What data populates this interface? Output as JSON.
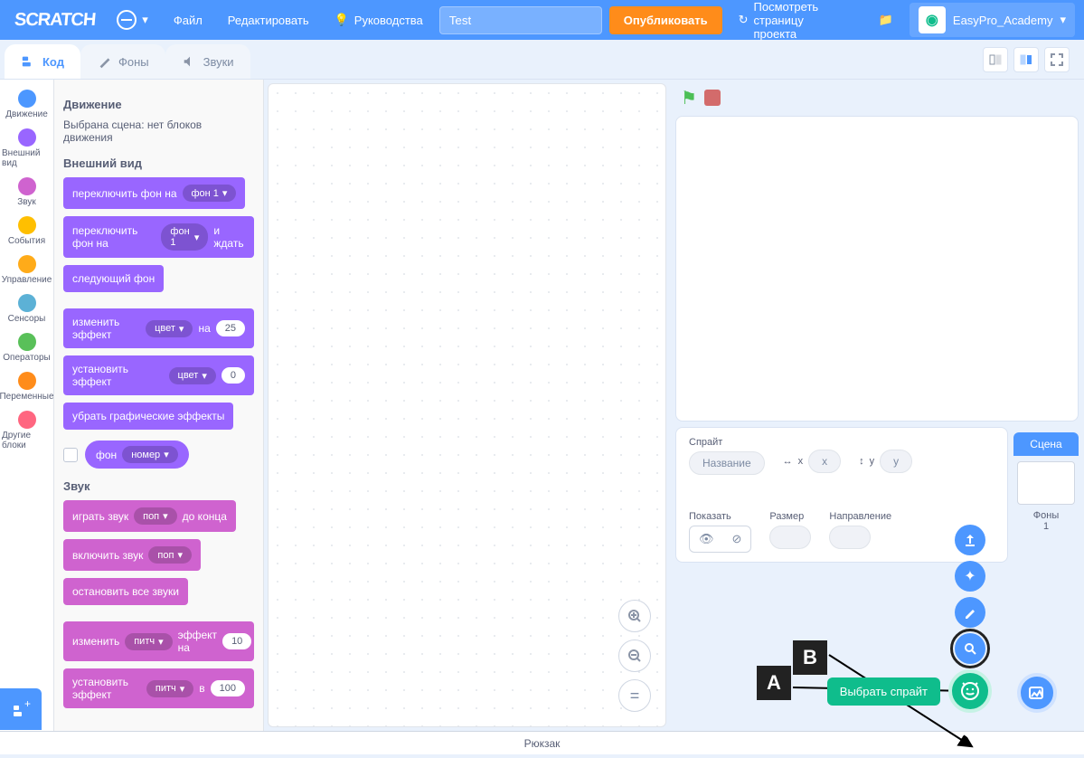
{
  "menubar": {
    "logo": "SCRATCH",
    "file": "Файл",
    "edit": "Редактировать",
    "tutorials": "Руководства",
    "project_title": "Test",
    "share": "Опубликовать",
    "see_project": "Посмотреть страницу проекта",
    "username": "EasyPro_Academy"
  },
  "tabs": {
    "code": "Код",
    "backdrops": "Фоны",
    "sounds": "Звуки"
  },
  "categories": [
    {
      "name": "Движение",
      "color": "#4c97ff"
    },
    {
      "name": "Внешний вид",
      "color": "#9966ff"
    },
    {
      "name": "Звук",
      "color": "#cf63cf"
    },
    {
      "name": "События",
      "color": "#ffbf00"
    },
    {
      "name": "Управление",
      "color": "#ffab19"
    },
    {
      "name": "Сенсоры",
      "color": "#5cb1d6"
    },
    {
      "name": "Операторы",
      "color": "#59c059"
    },
    {
      "name": "Переменные",
      "color": "#ff8c1a"
    },
    {
      "name": "Другие блоки",
      "color": "#ff6680"
    }
  ],
  "palette": {
    "motion_heading": "Движение",
    "motion_note": "Выбрана сцена: нет блоков движения",
    "looks_heading": "Внешний вид",
    "sound_heading": "Звук",
    "blocks": {
      "switch_bg": "переключить фон на",
      "bg1": "фон 1",
      "and_wait": "и ждать",
      "next_bg": "следующий фон",
      "change_effect": "изменить эффект",
      "set_effect": "установить эффект",
      "color": "цвет",
      "by": "на",
      "to": "в",
      "val25": "25",
      "val0": "0",
      "clear_effects": "убрать графические эффекты",
      "bg_reporter": "фон",
      "number": "номер",
      "play_sound": "играть звук",
      "pop": "поп",
      "until_done": "до конца",
      "start_sound": "включить звук",
      "stop_sounds": "остановить все звуки",
      "change_pitch": "изменить",
      "pitch": "питч",
      "effect_by": "эффект на",
      "val10": "10",
      "set_pitch": "установить эффект",
      "val100": "100"
    }
  },
  "sprite_panel": {
    "sprite_label": "Спрайт",
    "name_placeholder": "Название",
    "x_label": "x",
    "y_label": "y",
    "x_val": "x",
    "y_val": "y",
    "show_label": "Показать",
    "size_label": "Размер",
    "direction_label": "Направление"
  },
  "stage_panel": {
    "scene": "Сцена",
    "backdrops_label": "Фоны",
    "backdrops_count": "1"
  },
  "sprite_tooltip": "Выбрать спрайт",
  "backpack": "Рюкзак",
  "annotations": {
    "a": "A",
    "b": "B"
  }
}
